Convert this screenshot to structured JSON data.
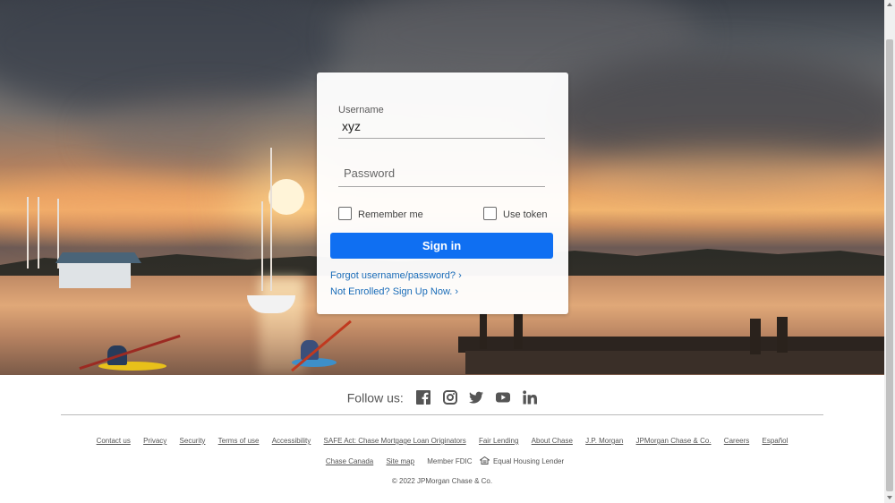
{
  "login": {
    "username_label": "Username",
    "username_value": "xyz",
    "password_placeholder": "Password",
    "remember_me": "Remember me",
    "use_token": "Use token",
    "signin_label": "Sign in",
    "forgot_link": "Forgot username/password? ›",
    "enroll_link": "Not Enrolled? Sign Up Now. ›"
  },
  "social": {
    "label": "Follow us:",
    "icons": [
      "facebook-icon",
      "instagram-icon",
      "twitter-icon",
      "youtube-icon",
      "linkedin-icon"
    ]
  },
  "footer": {
    "row1": [
      "Contact us",
      "Privacy",
      "Security",
      "Terms of use",
      "Accessibility",
      "SAFE Act: Chase Mortgage Loan Originators",
      "Fair Lending",
      "About Chase",
      "J.P. Morgan",
      "JPMorgan Chase & Co.",
      "Careers",
      "Español"
    ],
    "row2_links": [
      "Chase Canada",
      "Site map"
    ],
    "member_fdic": "Member FDIC",
    "equal_housing": "Equal Housing Lender",
    "copyright": "© 2022 JPMorgan Chase & Co."
  },
  "colors": {
    "primary_button": "#0f6ff2",
    "link": "#1a6cb8"
  }
}
